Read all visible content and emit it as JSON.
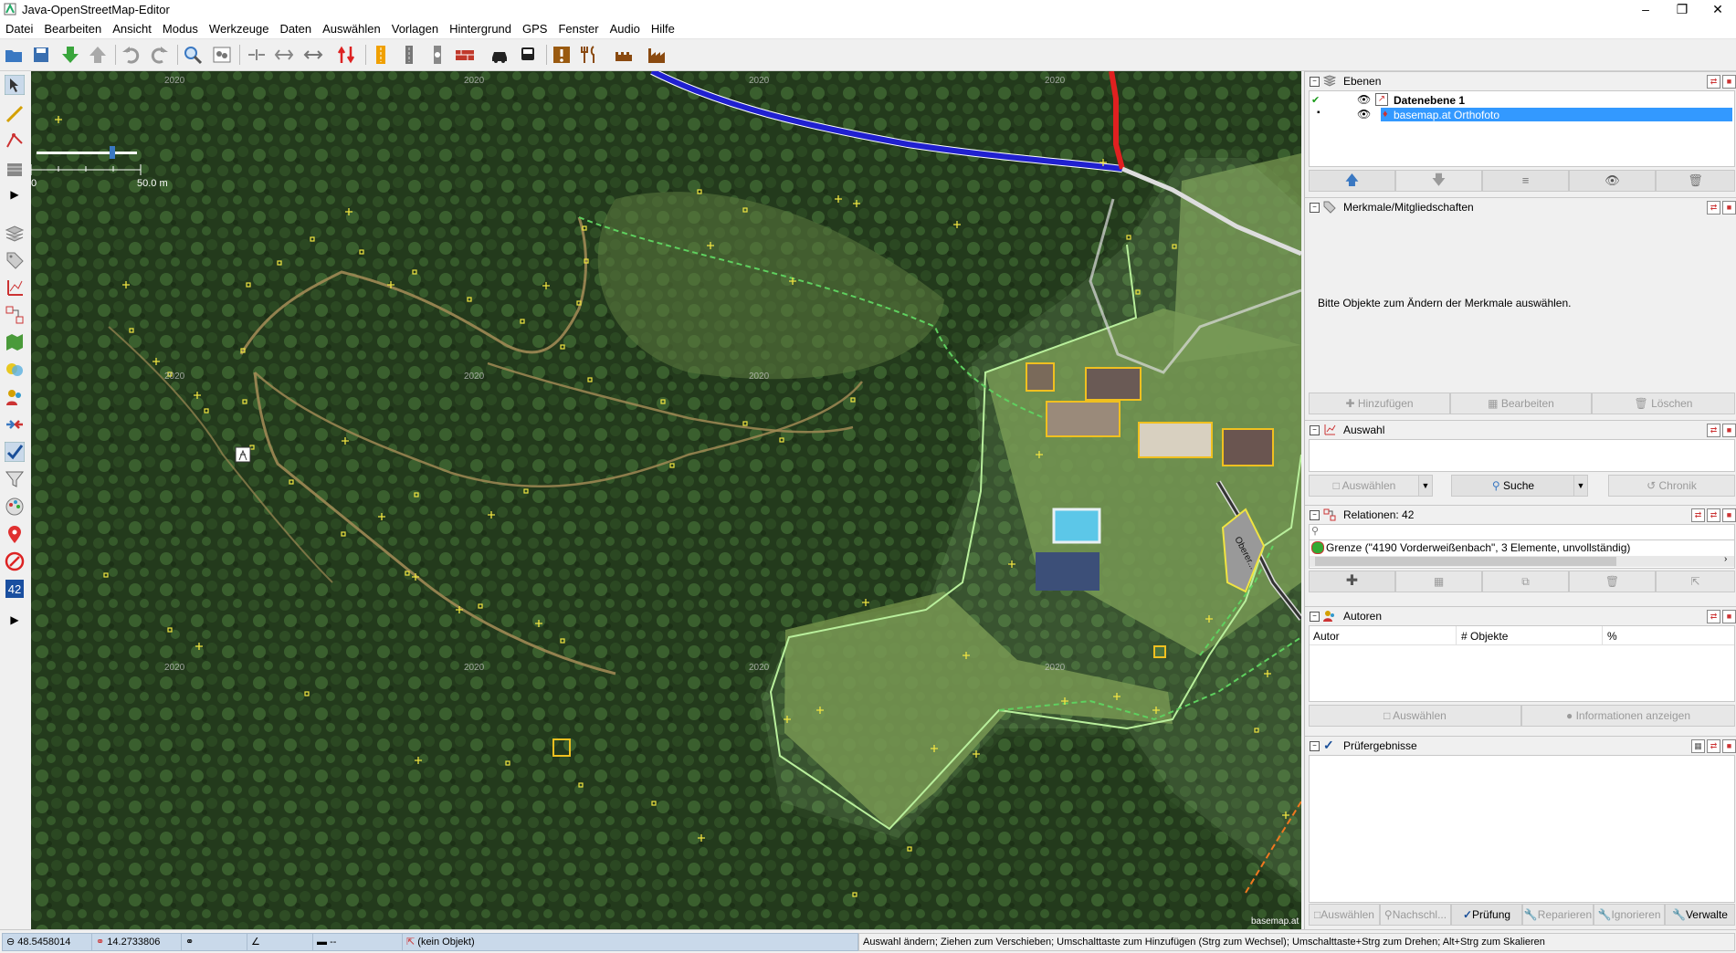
{
  "window": {
    "title": "Java-OpenStreetMap-Editor",
    "controls": [
      "minimize-icon",
      "maximize-icon",
      "close-icon"
    ]
  },
  "menu": [
    "Datei",
    "Bearbeiten",
    "Ansicht",
    "Modus",
    "Werkzeuge",
    "Daten",
    "Auswählen",
    "Vorlagen",
    "Hintergrund",
    "GPS",
    "Fenster",
    "Audio",
    "Hilfe"
  ],
  "map": {
    "scale_zero": "0",
    "scale_label": "50.0 m",
    "imagery_year": "2020",
    "attribution": "basemap.at",
    "street_label": "Oberer..."
  },
  "layers": {
    "title": "Ebenen",
    "items": [
      {
        "name": "Datenebene 1",
        "active": true
      },
      {
        "name": "basemap.at Orthofoto",
        "selected": true
      }
    ]
  },
  "tags": {
    "title": "Merkmale/Mitgliedschaften",
    "empty_text": "Bitte Objekte zum Ändern der Merkmale auswählen.",
    "buttons": [
      "Hinzufügen",
      "Bearbeiten",
      "Löschen"
    ]
  },
  "selection": {
    "title": "Auswahl",
    "buttons": [
      "Auswählen",
      "Suche",
      "Chronik"
    ]
  },
  "relations": {
    "title": "Relationen: 42",
    "item": "Grenze (\"4190 Vorderweißenbach\", 3 Elemente, unvollständig)"
  },
  "authors": {
    "title": "Autoren",
    "columns": [
      "Autor",
      "# Objekte",
      "%"
    ],
    "buttons": [
      "Auswählen",
      "Informationen anzeigen"
    ]
  },
  "validator": {
    "title": "Prüfergebnisse",
    "buttons": [
      "Auswählen",
      "Nachschl...",
      "Prüfung",
      "Reparieren",
      "Ignorieren",
      "Verwalte"
    ]
  },
  "status": {
    "lat": "48.5458014",
    "lon": "14.2733806",
    "heading": "",
    "angle": "",
    "distance": "--",
    "object": "(kein Objekt)",
    "help": "Auswahl ändern; Ziehen zum Verschieben; Umschalttaste zum Hinzufügen (Strg zum Wechsel); Umschalttaste+Strg zum Drehen; Alt+Strg zum Skalieren"
  },
  "colors": {
    "selection_blue": "#3399ff",
    "way_yellow": "#f0e442",
    "boundary_green": "#90ee90",
    "road_blue": "#2020d0",
    "road_red": "#e02020"
  }
}
